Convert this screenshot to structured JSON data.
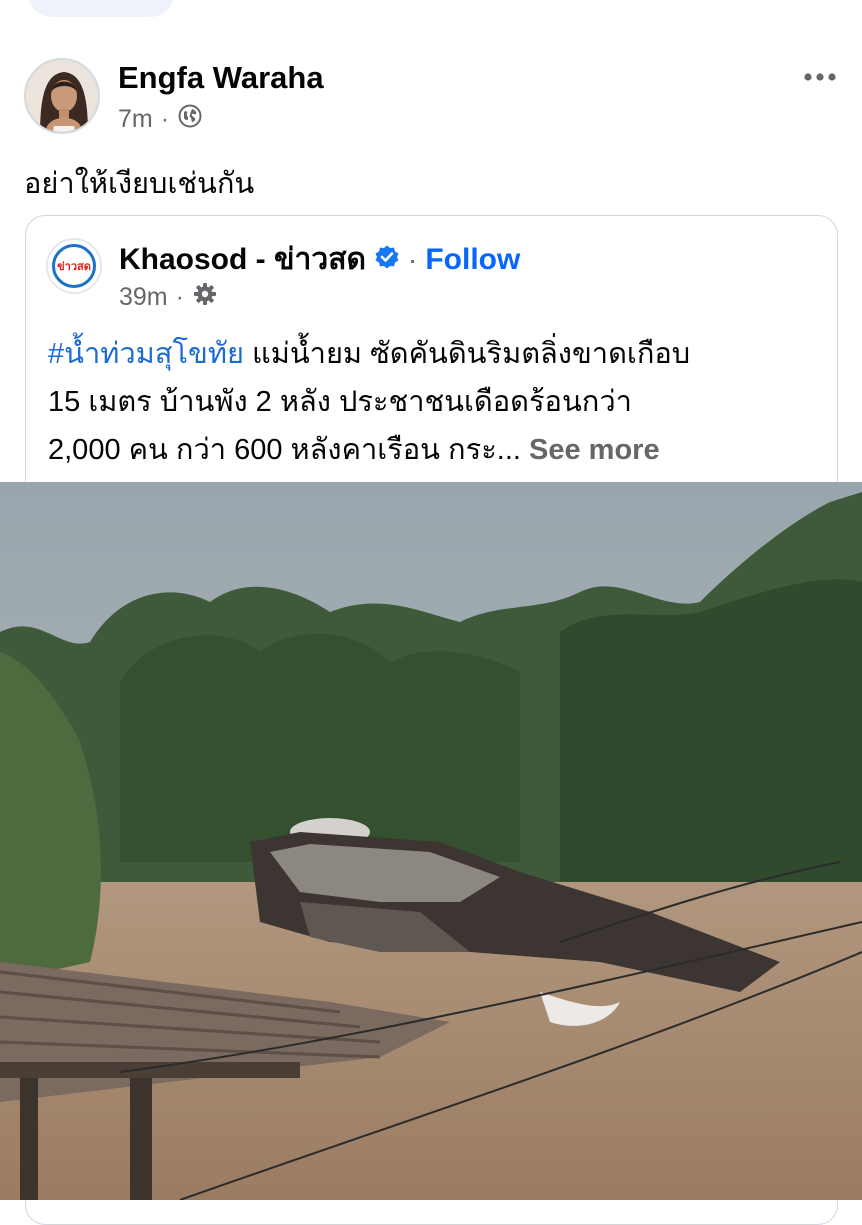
{
  "post": {
    "author": "Engfa Waraha",
    "time": "7m",
    "separator": "·",
    "caption": "อย่าให้เงียบเช่นกัน",
    "icons": {
      "privacy": "globe-icon",
      "more": "more-horizontal-icon"
    }
  },
  "shared": {
    "logo_text": "ข่าวสด",
    "source_name": "Khaosod - ข่าวสด",
    "separator": "·",
    "follow_label": "Follow",
    "time": "39m",
    "icons": {
      "verified": "verified-badge-icon",
      "privacy": "gear-icon"
    },
    "hashtag": "#น้ำท่วมสุโขทัย",
    "line1_rest": " แม่น้ำยม ซัดคันดินริมตลิ่งขาดเกือบ",
    "line2": "15 เมตร บ้านพัง 2 หลัง ประชาชนเดือดร้อนกว่า",
    "line3": "2,000 คน กว่า 600 หลังคาเรือน กระ... ",
    "see_more": "See more"
  },
  "colors": {
    "link": "#0866ff",
    "hashtag": "#1b6bd3",
    "secondary_text": "#65676b",
    "verified": "#1877f2"
  }
}
